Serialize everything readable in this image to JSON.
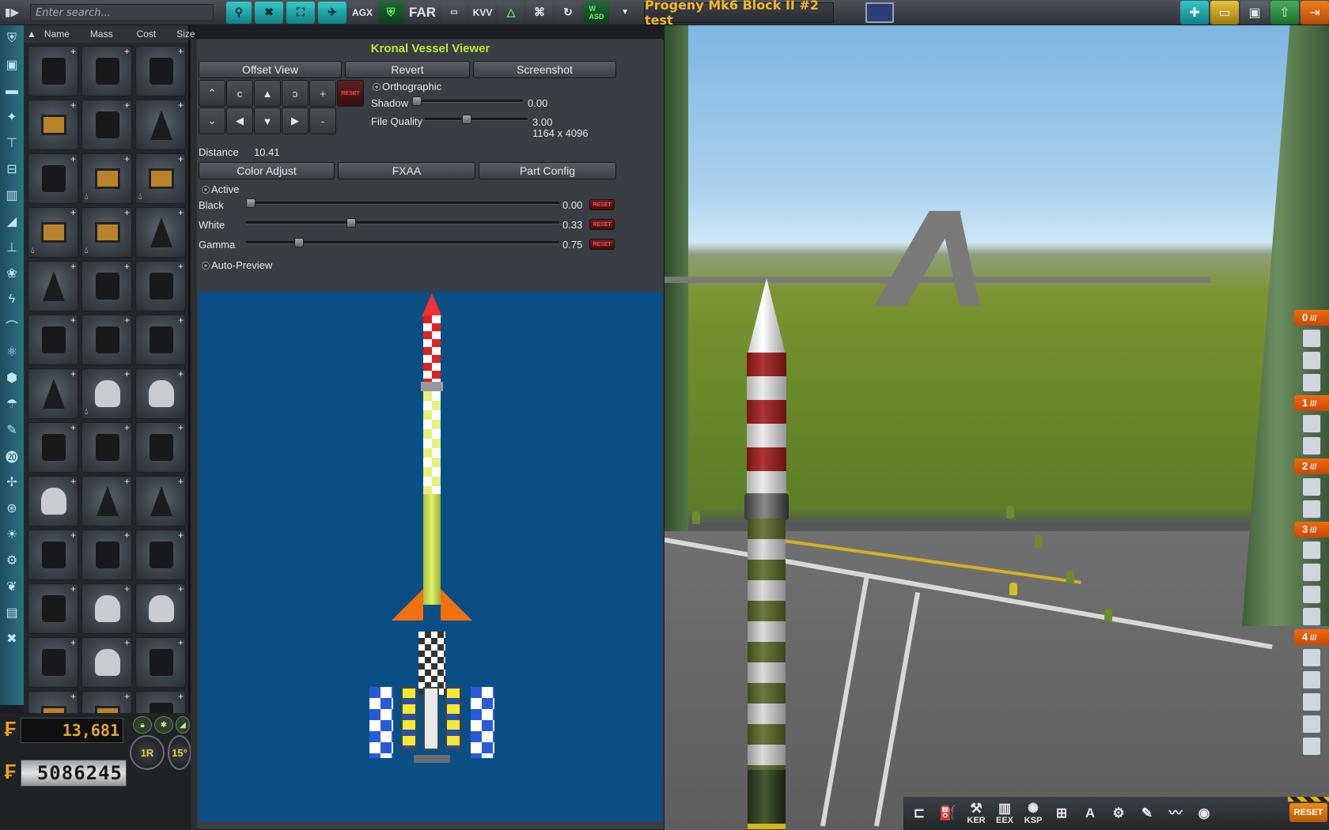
{
  "topbar": {
    "search_placeholder": "Enter search...",
    "mod_buttons": [
      "AGX",
      "FAR",
      "KVV"
    ],
    "wasd_label": "W\nASD",
    "vessel_name": "Progeny Mk6 Block II #2 test"
  },
  "parts_list": {
    "columns": [
      "Name",
      "Mass",
      "Cost",
      "Size"
    ],
    "category_icons": [
      "shield-icon",
      "pod-icon",
      "fuel-tank-icon",
      "engine-icon",
      "structural-icon",
      "coupling-icon",
      "payload-icon",
      "aero-icon",
      "ground-icon",
      "thermal-icon",
      "electrical-icon",
      "communication-icon",
      "science-icon",
      "cargo-icon",
      "parachute-icon",
      "robotics-icon",
      "kb-icon",
      "rotor-icon",
      "fan-icon",
      "light-icon",
      "rover-icon",
      "plant-icon",
      "tank-icon",
      "tools-icon"
    ]
  },
  "funds": {
    "funds_value": "13,681",
    "odometer_value": "5086245",
    "round_button_label": "1R",
    "angle_snap_label": "15°"
  },
  "kvv": {
    "title": "Kronal Vessel Viewer",
    "buttons": {
      "offset_view": "Offset View",
      "revert": "Revert",
      "screenshot": "Screenshot",
      "color_adjust": "Color Adjust",
      "fxaa": "FXAA",
      "part_config": "Part Config"
    },
    "pad_buttons": {
      "up_curve": "⌃",
      "c_left": "c",
      "up": "▲",
      "c_right": "ↄ",
      "plus": "+",
      "down_curve": "⌄",
      "left": "◀",
      "down": "▼",
      "right": "▶",
      "minus": "-",
      "reset": "RESET"
    },
    "orthographic_label": "Orthographic",
    "shadow": {
      "label": "Shadow",
      "value": "0.00",
      "fraction": 0.0
    },
    "file_quality": {
      "label": "File Quality",
      "value": "3.00",
      "resolution": "1164 x 4096",
      "fraction": 0.4
    },
    "distance": {
      "label": "Distance",
      "value": "10.41"
    },
    "active_label": "Active",
    "color_sliders": [
      {
        "label": "Black",
        "value": "0.00",
        "fraction": 0.0
      },
      {
        "label": "White",
        "value": "0.33",
        "fraction": 0.33
      },
      {
        "label": "Gamma",
        "value": "0.75",
        "fraction": 0.16
      }
    ],
    "auto_preview_label": "Auto-Preview"
  },
  "staging": {
    "stages": [
      {
        "number": "0",
        "icons": 3
      },
      {
        "number": "1",
        "icons": 2
      },
      {
        "number": "2",
        "icons": 2
      },
      {
        "number": "3",
        "icons": 4
      },
      {
        "number": "4",
        "icons": 5
      }
    ]
  },
  "app_toolbar": {
    "apps": [
      {
        "name": "launch-clamp-icon",
        "label": ""
      },
      {
        "name": "fuel-icon",
        "label": ""
      },
      {
        "name": "ker-icon",
        "label": "KER"
      },
      {
        "name": "eex-icon",
        "label": "EEX"
      },
      {
        "name": "ksp-icon",
        "label": "KSP"
      },
      {
        "name": "kk-icon",
        "label": ""
      },
      {
        "name": "autopilot-icon",
        "label": ""
      },
      {
        "name": "gear-icon",
        "label": ""
      },
      {
        "name": "notes-icon",
        "label": ""
      },
      {
        "name": "signal-icon",
        "label": ""
      },
      {
        "name": "antenna-icon",
        "label": ""
      }
    ],
    "reset_label": "RESET"
  },
  "colors": {
    "kvv_title": "#b8e83a",
    "vessel_name": "#f4b62b",
    "stage_orange": "#f26a10",
    "preview_bg": "#0a4e86"
  }
}
